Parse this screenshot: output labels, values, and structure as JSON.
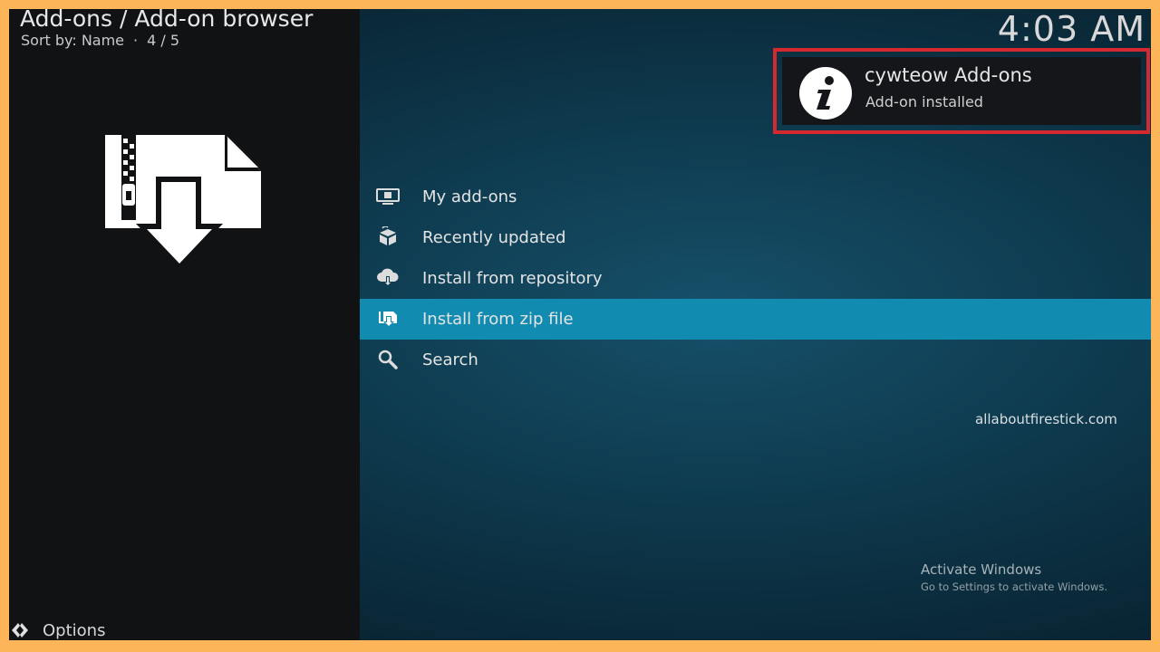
{
  "header": {
    "breadcrumb": "Add-ons / Add-on browser",
    "sort_label": "Sort by: Name",
    "position": "4 / 5",
    "clock": "4:03 AM"
  },
  "hero": {
    "icon": "zip-download-icon"
  },
  "notification": {
    "icon": "info-icon",
    "title": "cywteow Add-ons",
    "subtitle": "Add-on installed",
    "highlight_color": "#d6282f"
  },
  "menu": {
    "items": [
      {
        "label": "My add-ons",
        "icon": "monitor-box-icon"
      },
      {
        "label": "Recently updated",
        "icon": "box-refresh-icon"
      },
      {
        "label": "Install from repository",
        "icon": "cloud-download-icon"
      },
      {
        "label": "Install from zip file",
        "icon": "zip-install-icon",
        "selected": true
      },
      {
        "label": "Search",
        "icon": "search-icon"
      }
    ],
    "selected_color": "#128bb0"
  },
  "footer": {
    "options_label": "Options",
    "options_icon": "options-gear-icon"
  },
  "watermark": "allaboutfirestick.com",
  "activate_windows": {
    "title": "Activate Windows",
    "subtitle": "Go to Settings to activate Windows."
  },
  "colors": {
    "frame_border": "#fdb55a",
    "left_panel": "#111214"
  }
}
